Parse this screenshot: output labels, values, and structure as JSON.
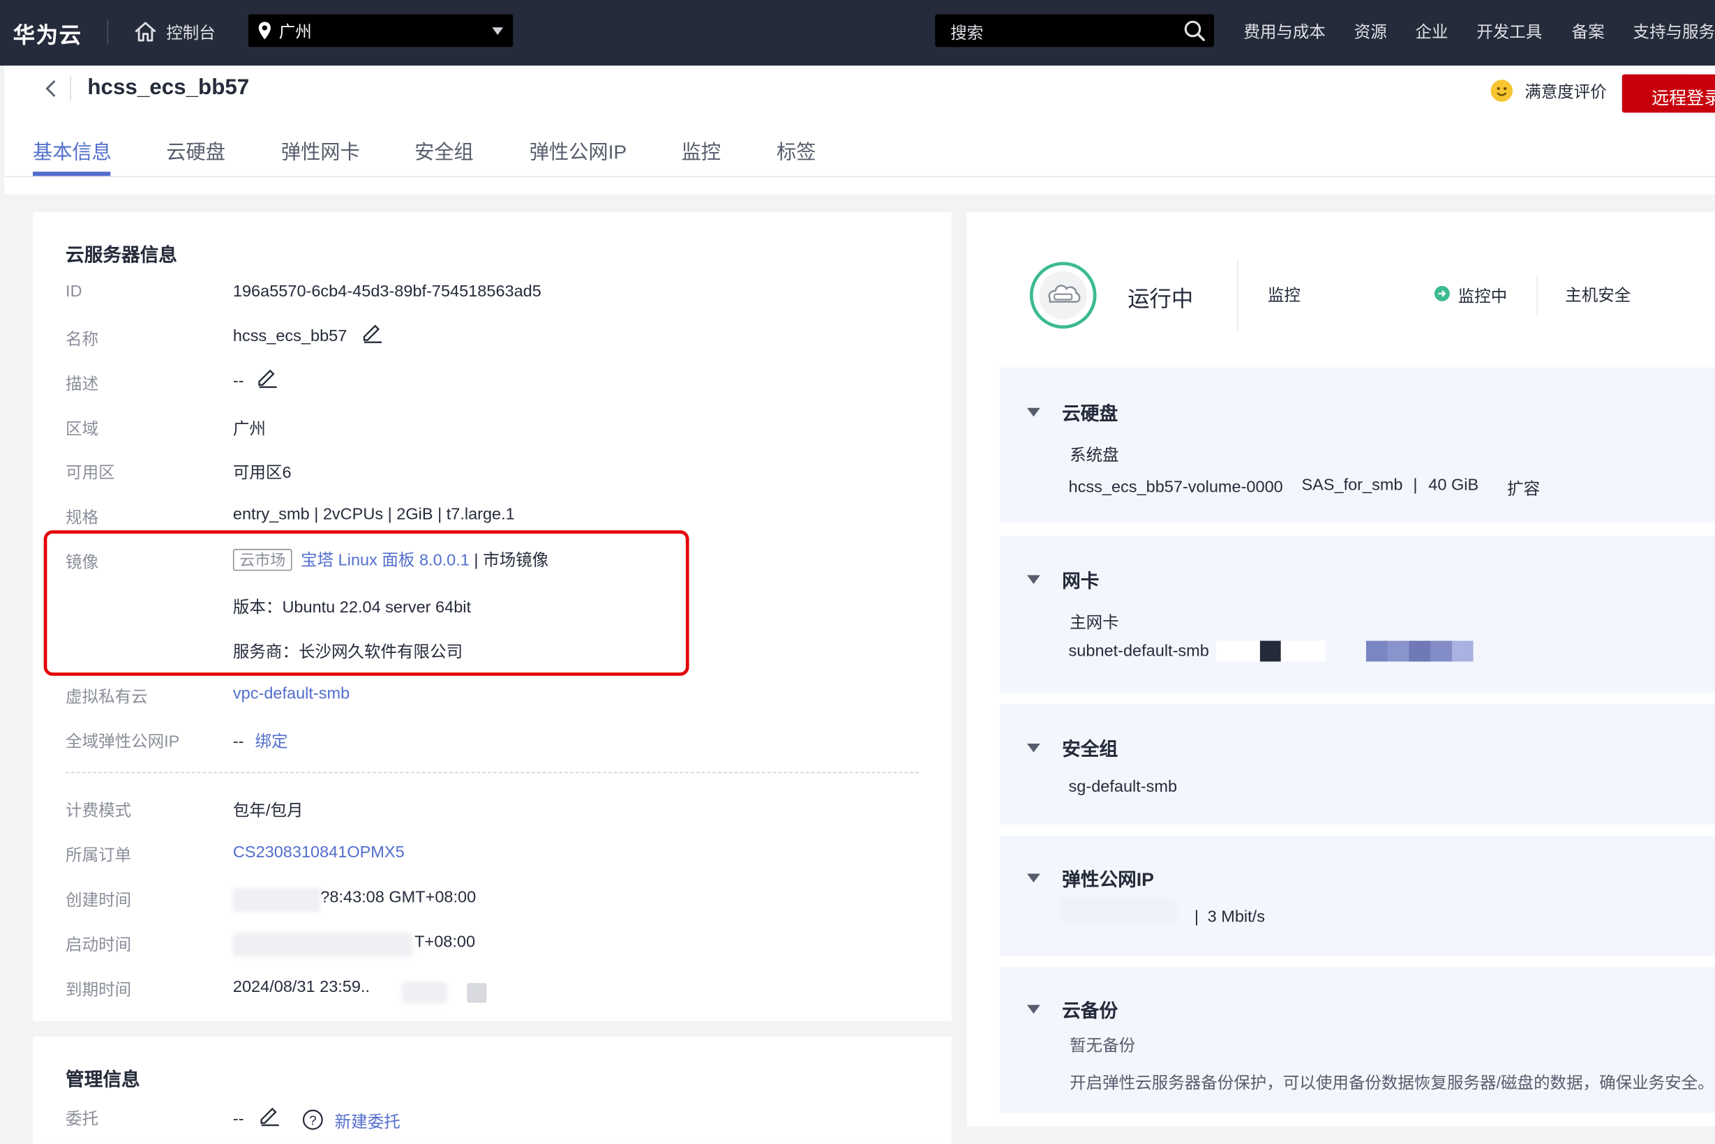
{
  "topbar": {
    "logo": "华为云",
    "console": "控制台",
    "region": "广州",
    "search_placeholder": "搜索",
    "nav": [
      "费用与成本",
      "资源",
      "企业",
      "开发工具",
      "备案",
      "支持与服务"
    ]
  },
  "header": {
    "title": "hcss_ecs_bb57",
    "satisfaction": "满意度评价",
    "remote_login": "远程登录",
    "tabs": [
      "基本信息",
      "云硬盘",
      "弹性网卡",
      "安全组",
      "弹性公网IP",
      "监控",
      "标签"
    ]
  },
  "server_info": {
    "section_title": "云服务器信息",
    "id_label": "ID",
    "id_value": "196a5570-6cb4-45d3-89bf-754518563ad5",
    "name_label": "名称",
    "name_value": "hcss_ecs_bb57",
    "desc_label": "描述",
    "desc_value": "--",
    "region_label": "区域",
    "region_value": "广州",
    "az_label": "可用区",
    "az_value": "可用区6",
    "spec_label": "规格",
    "spec_value": "entry_smb | 2vCPUs | 2GiB | t7.large.1",
    "image_label": "镜像",
    "image_tag": "云市场",
    "image_name": "宝塔 Linux 面板 8.0.0.1",
    "image_sep": "|",
    "image_type": "市场镜像",
    "image_version": "版本：Ubuntu 22.04 server 64bit",
    "image_vendor": "服务商：长沙网久软件有限公司",
    "vpc_label": "虚拟私有云",
    "vpc_value": "vpc-default-smb",
    "eip_label": "全域弹性公网IP",
    "eip_value": "--",
    "eip_bind": "绑定",
    "billing_label": "计费模式",
    "billing_value": "包年/包月",
    "order_label": "所属订单",
    "order_value": "CS2308310841OPMX5",
    "created_label": "创建时间",
    "created_value": "?8:43:08 GMT+08:00",
    "started_label": "启动时间",
    "started_value": "T+08:00",
    "expire_label": "到期时间",
    "expire_value": "2024/08/31 23:59.."
  },
  "mgmt": {
    "section_title": "管理信息",
    "delegate_label": "委托",
    "delegate_value": "--",
    "new_delegate": "新建委托"
  },
  "status": {
    "state": "运行中",
    "monitor": "监控",
    "monitoring": "监控中",
    "host_security": "主机安全"
  },
  "disk": {
    "title": "云硬盘",
    "sub": "系统盘",
    "volume": "hcss_ecs_bb57-volume-0000",
    "type": "SAS_for_smb",
    "sep": "|",
    "size": "40 GiB",
    "expand": "扩容"
  },
  "nic": {
    "title": "网卡",
    "sub": "主网卡",
    "subnet": "subnet-default-smb"
  },
  "sg": {
    "title": "安全组",
    "name": "sg-default-smb"
  },
  "eip": {
    "title": "弹性公网IP",
    "sep": "|",
    "bandwidth": "3 Mbit/s"
  },
  "backup": {
    "title": "云备份",
    "none": "暂无备份",
    "desc": "开启弹性云服务器备份保护，可以使用备份数据恢复服务器/磁盘的数据，确保业务安全。"
  },
  "colors": {
    "brand_red": "#c7000b",
    "link_blue": "#526ecc",
    "topbar": "#252b3a",
    "running_green": "#3cba92"
  }
}
